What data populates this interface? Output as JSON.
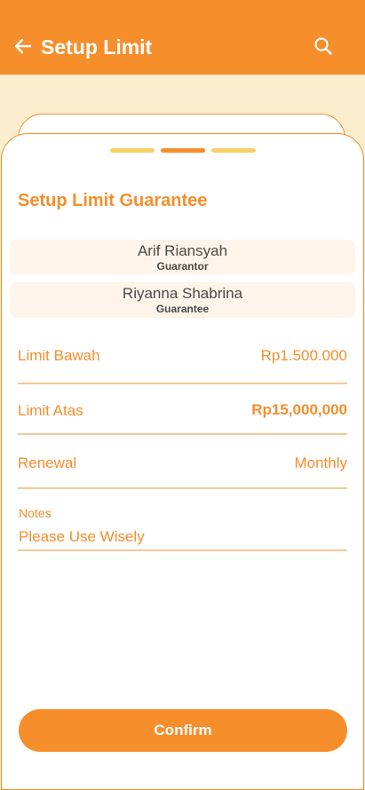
{
  "appbar": {
    "title": "Setup Limit",
    "back_icon": "arrow-left-icon",
    "search_icon": "search-icon"
  },
  "stepper": {
    "total": 3,
    "current": 2
  },
  "section_title": "Setup Limit Guarantee",
  "parties": [
    {
      "name": "Arif Riansyah",
      "role": "Guarantor"
    },
    {
      "name": "Riyanna Shabrina",
      "role": "Guarantee"
    }
  ],
  "rows": [
    {
      "label": "Limit Bawah",
      "value": "Rp1.500.000"
    },
    {
      "label": "Limit Atas",
      "value": "Rp15,000,000"
    },
    {
      "label": "Renewal",
      "value": "Monthly"
    }
  ],
  "notes": {
    "label": "Notes",
    "value": "Please Use Wisely"
  },
  "confirm_label": "Confirm",
  "colors": {
    "primary": "#F68E2B",
    "accent": "#F7D166",
    "background": "#FDEDCF",
    "party_background": "#FEF4EA"
  }
}
